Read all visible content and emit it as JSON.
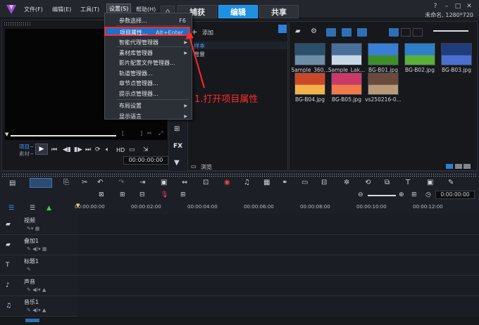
{
  "menubar": {
    "items": [
      "文件(F)",
      "编辑(E)",
      "工具(T)",
      "设置(S)",
      "帮助(H)"
    ],
    "tabs": [
      "捕获",
      "编辑",
      "共享"
    ],
    "active_tab": "编辑",
    "project_info": "未命名, 1280*720"
  },
  "settings_menu": {
    "items": [
      {
        "label": "参数选择...",
        "shortcut": "F6"
      },
      {
        "label": "项目属性...",
        "shortcut": "Alt+Enter",
        "highlighted": true
      },
      {
        "label": "智能代理管理器",
        "submenu": true
      },
      {
        "label": "素材库管理器",
        "submenu": true
      },
      {
        "label": "影片配置文件管理器...",
        "submenu": false
      },
      {
        "label": "轨道管理器..."
      },
      {
        "label": "章节点管理器..."
      },
      {
        "label": "提示点管理器..."
      },
      {
        "label": "布局设置",
        "submenu": true
      },
      {
        "label": "显示语言",
        "submenu": true
      }
    ]
  },
  "annotation": {
    "text": "1.打开项目属性",
    "color": "#ff2b2b"
  },
  "library": {
    "add_label": "添加",
    "folders": [
      "样本",
      "背景"
    ],
    "browse_label": "浏览",
    "thumbnails": [
      {
        "label": "Sample_360...",
        "colors": [
          "#2b4e6b",
          "#6d8ea8"
        ]
      },
      {
        "label": "Sample_Lak...",
        "colors": [
          "#4a6f9a",
          "#c9d8e6"
        ]
      },
      {
        "label": "BG-B01.jpg",
        "colors": [
          "#3a7ed6",
          "#3e8f2a"
        ]
      },
      {
        "label": "BG-B02.jpg",
        "colors": [
          "#2f7fc8",
          "#5ab03a"
        ]
      },
      {
        "label": "BG-B03.jpg",
        "colors": [
          "#1f3d7a",
          "#4b6fd0"
        ]
      },
      {
        "label": "BG-B04.jpg",
        "colors": [
          "#c9482a",
          "#f2b24a"
        ]
      },
      {
        "label": "BG-B05.jpg",
        "colors": [
          "#c93a6a",
          "#f07a4a"
        ]
      },
      {
        "label": "vs250216-0...",
        "colors": [
          "#6a4a3a",
          "#b89a7a"
        ]
      }
    ]
  },
  "player": {
    "project_label": "项目~",
    "clip_label": "素材~",
    "hd_label": "HD",
    "timecode": "00:00:00:00",
    "fx_label": "FX"
  },
  "timeline": {
    "ruler": [
      "00:00:00:00",
      "00:00:02:00",
      "00:00:04:00",
      "00:00:06:00",
      "00:00:08:00",
      "00:00:10:00",
      "00:00:12:00"
    ],
    "timecode": "0:00:00:00",
    "tracks": [
      {
        "name": "视频"
      },
      {
        "name": "叠加1"
      },
      {
        "name": "标题1"
      },
      {
        "name": "声音"
      },
      {
        "name": "音乐1"
      }
    ]
  }
}
